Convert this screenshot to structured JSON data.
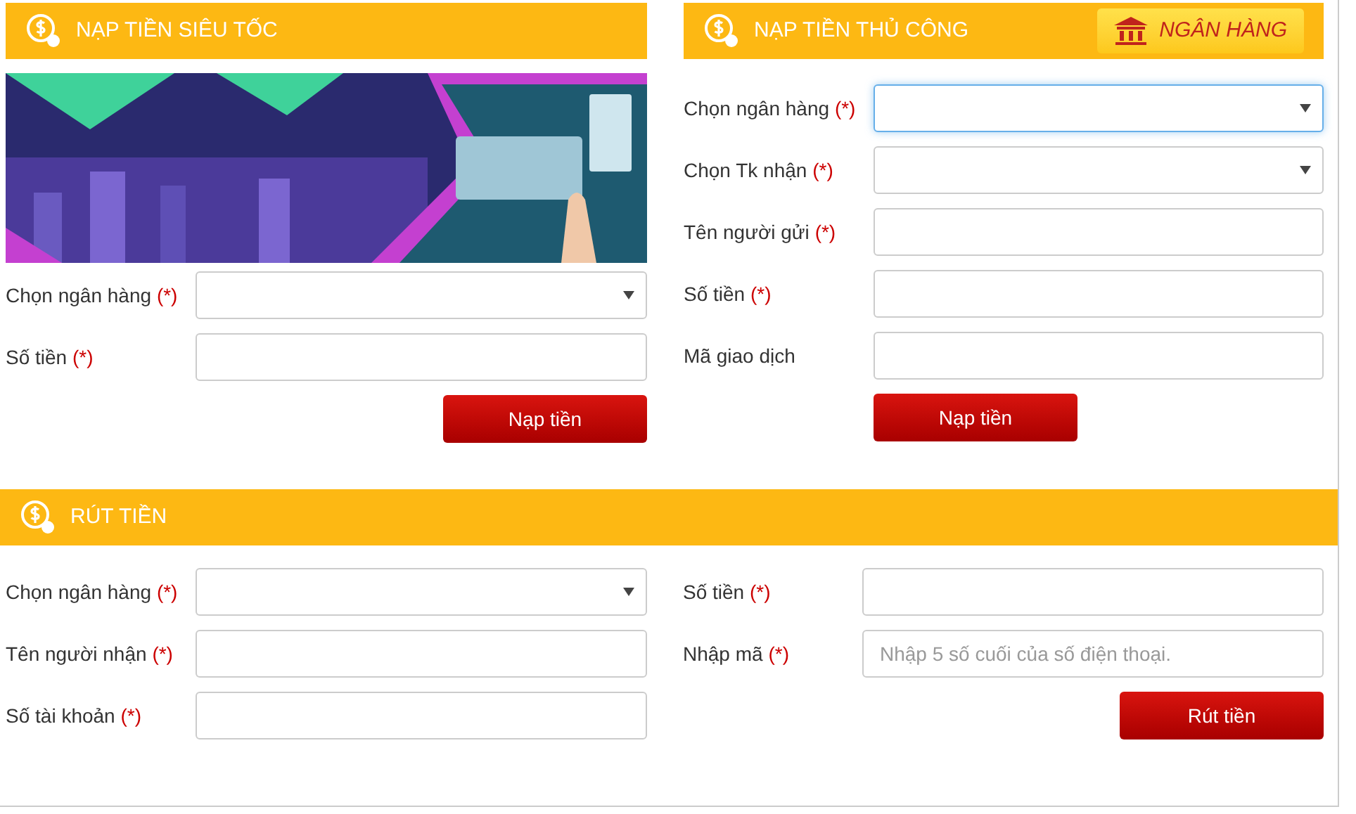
{
  "top_sections": [
    {
      "title": "NẠP TIỀN SIÊU TỐC",
      "banner": {
        "kind": "picture"
      },
      "button": "Nạp tiền",
      "fields": [
        {
          "kind": "select",
          "label": "Chọn ngân hàng",
          "required_mark": "(*)",
          "focused": false
        },
        {
          "kind": "input",
          "label": "Số tiền",
          "required_mark": "(*)",
          "focused": false
        }
      ]
    },
    {
      "title": "NẠP TIỀN THỦ CÔNG",
      "badge": "NGÂN HÀNG",
      "button": "Nạp tiền",
      "fields": [
        {
          "kind": "select",
          "label": "Chọn ngân hàng",
          "required_mark": "(*)",
          "focused": true
        },
        {
          "kind": "select",
          "label": "Chọn Tk nhận",
          "required_mark": "(*)",
          "focused": false
        },
        {
          "kind": "input",
          "label": "Tên người gửi",
          "required_mark": "(*)",
          "focused": false
        },
        {
          "kind": "input",
          "label": "Số tiền",
          "required_mark": "(*)",
          "focused": false
        },
        {
          "kind": "input",
          "label": "Mã giao dịch",
          "focused": false
        }
      ]
    }
  ],
  "withdraw": {
    "title": "RÚT TIỀN",
    "button": "Rút tiền",
    "left_fields": [
      {
        "kind": "select",
        "label": "Chọn ngân hàng",
        "required_mark": "(*)",
        "focused": false
      },
      {
        "kind": "input",
        "label": "Tên người nhận",
        "required_mark": "(*)",
        "focused": false
      },
      {
        "kind": "input",
        "label": "Số tài khoản",
        "required_mark": "(*)",
        "focused": false
      }
    ],
    "right_fields": [
      {
        "kind": "input",
        "label": "Số tiền",
        "required_mark": "(*)",
        "focused": false
      },
      {
        "kind": "input",
        "label": "Nhập mã",
        "required_mark": "(*)",
        "placeholder": "Nhập 5 số cuối của số điện thoại.",
        "focused": false
      }
    ]
  }
}
